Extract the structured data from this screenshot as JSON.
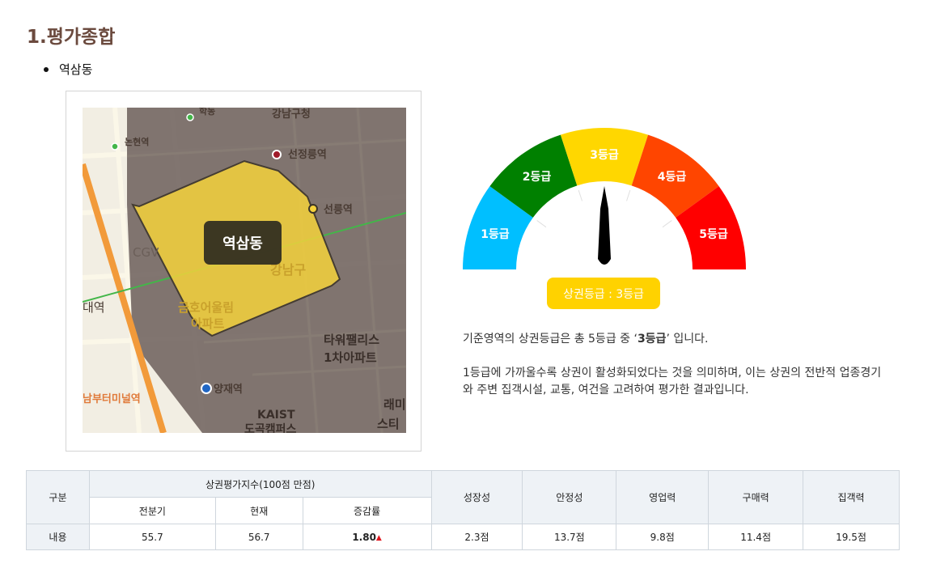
{
  "section": {
    "title": "1.평가종합",
    "area": "역삼동"
  },
  "map": {
    "center_label": "역삼동",
    "labels": {
      "gangnamgucheong": "강남구청",
      "seonjeongneung": "선정릉역",
      "nonhyeon": "논현역",
      "hakdong": "학동",
      "seolleung": "선릉역",
      "cgv": "CGV",
      "gangnamgu": "강남구",
      "daeyeok": "대역",
      "geumho": "금호어울림",
      "apt": "아파트",
      "tower1": "타워팰리스",
      "tower2": "1차아파트",
      "yangjae": "양재역",
      "terminal": "남부터미널역",
      "kaist": "KAIST",
      "dogok": "도곡캠퍼스",
      "rae": "래미",
      "seuti": "스티"
    }
  },
  "gauge": {
    "segments": [
      {
        "label": "1등급",
        "color": "#00bfff"
      },
      {
        "label": "2등급",
        "color": "#008000"
      },
      {
        "label": "3등급",
        "color": "#ffd700"
      },
      {
        "label": "4등급",
        "color": "#ff4500"
      },
      {
        "label": "5등급",
        "color": "#ff0000"
      }
    ],
    "current_grade": 3,
    "badge": "상권등급 : 3등급"
  },
  "description": {
    "line1_prefix": "기준영역의 상권등급은 총 5등급 중 ‘",
    "line1_grade": "3등급",
    "line1_suffix": "’ 입니다.",
    "para2": "1등급에 가까울수록 상권이 활성화되었다는 것을 의미하며, 이는 상권의 전반적 업종경기와 주변 집객시설, 교통, 여건을 고려하여 평가한 결과입니다."
  },
  "table": {
    "h_category": "구분",
    "h_index": "상권평가지수(100점 만점)",
    "h_prev": "전분기",
    "h_current": "현재",
    "h_change": "증감률",
    "h_growth": "성장성",
    "h_stability": "안정성",
    "h_sales": "영업력",
    "h_purchase": "구매력",
    "h_attraction": "집객력",
    "row_label": "내용",
    "prev": "55.7",
    "current": "56.7",
    "change": "1.80",
    "change_icon": "up-triangle-icon",
    "growth": "2.3점",
    "stability": "13.7점",
    "sales": "9.8점",
    "purchase": "11.4점",
    "attraction": "19.5점"
  }
}
